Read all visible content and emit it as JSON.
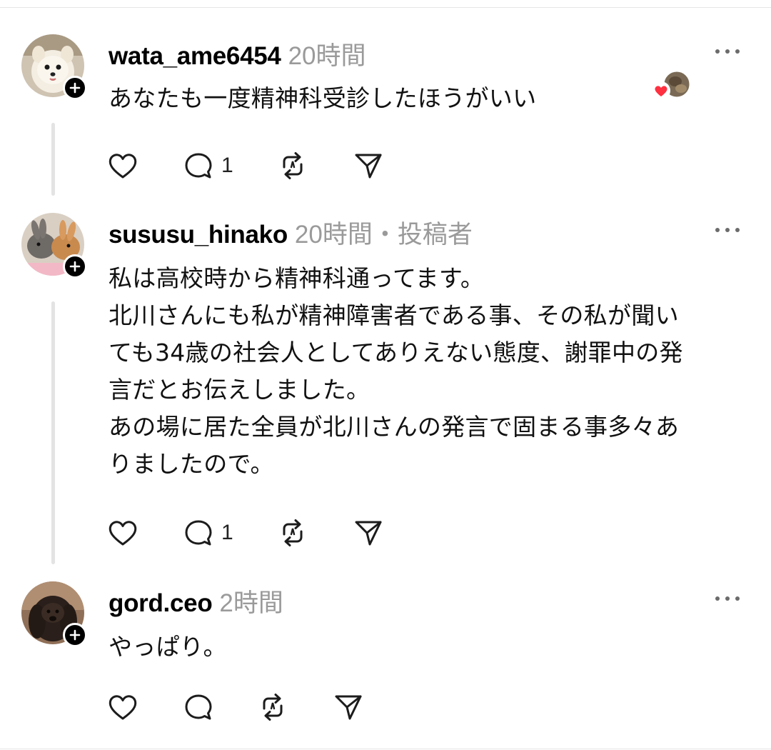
{
  "posts": [
    {
      "username": "wata_ame6454",
      "meta": "20時間",
      "text": "あなたも一度精神科受診したほうがいい",
      "reply_count": "1",
      "repost_count": ""
    },
    {
      "username": "sususu_hinako",
      "meta": "20時間・投稿者",
      "lines": [
        "私は高校時から精神科通ってます。",
        "北川さんにも私が精神障害者である事、その私が聞い",
        "ても34歳の社会人としてありえない態度、謝罪中の発",
        "言だとお伝えしました。",
        "あの場に居た全員が北川さんの発言で固まる事多々あ",
        "りましたので。"
      ],
      "reply_count": "1"
    },
    {
      "username": "gord.ceo",
      "meta": "2時間",
      "text": "やっぱり。",
      "reply_count": ""
    }
  ],
  "icons": {
    "like": "heart-icon",
    "reply": "comment-icon",
    "repost": "repost-icon",
    "share": "send-icon",
    "more": "more-icon",
    "follow": "plus-icon"
  },
  "colors": {
    "heart_badge": "#ff3040",
    "meta_gray": "#9a9a9a",
    "thread_line": "#e3e3e3"
  }
}
